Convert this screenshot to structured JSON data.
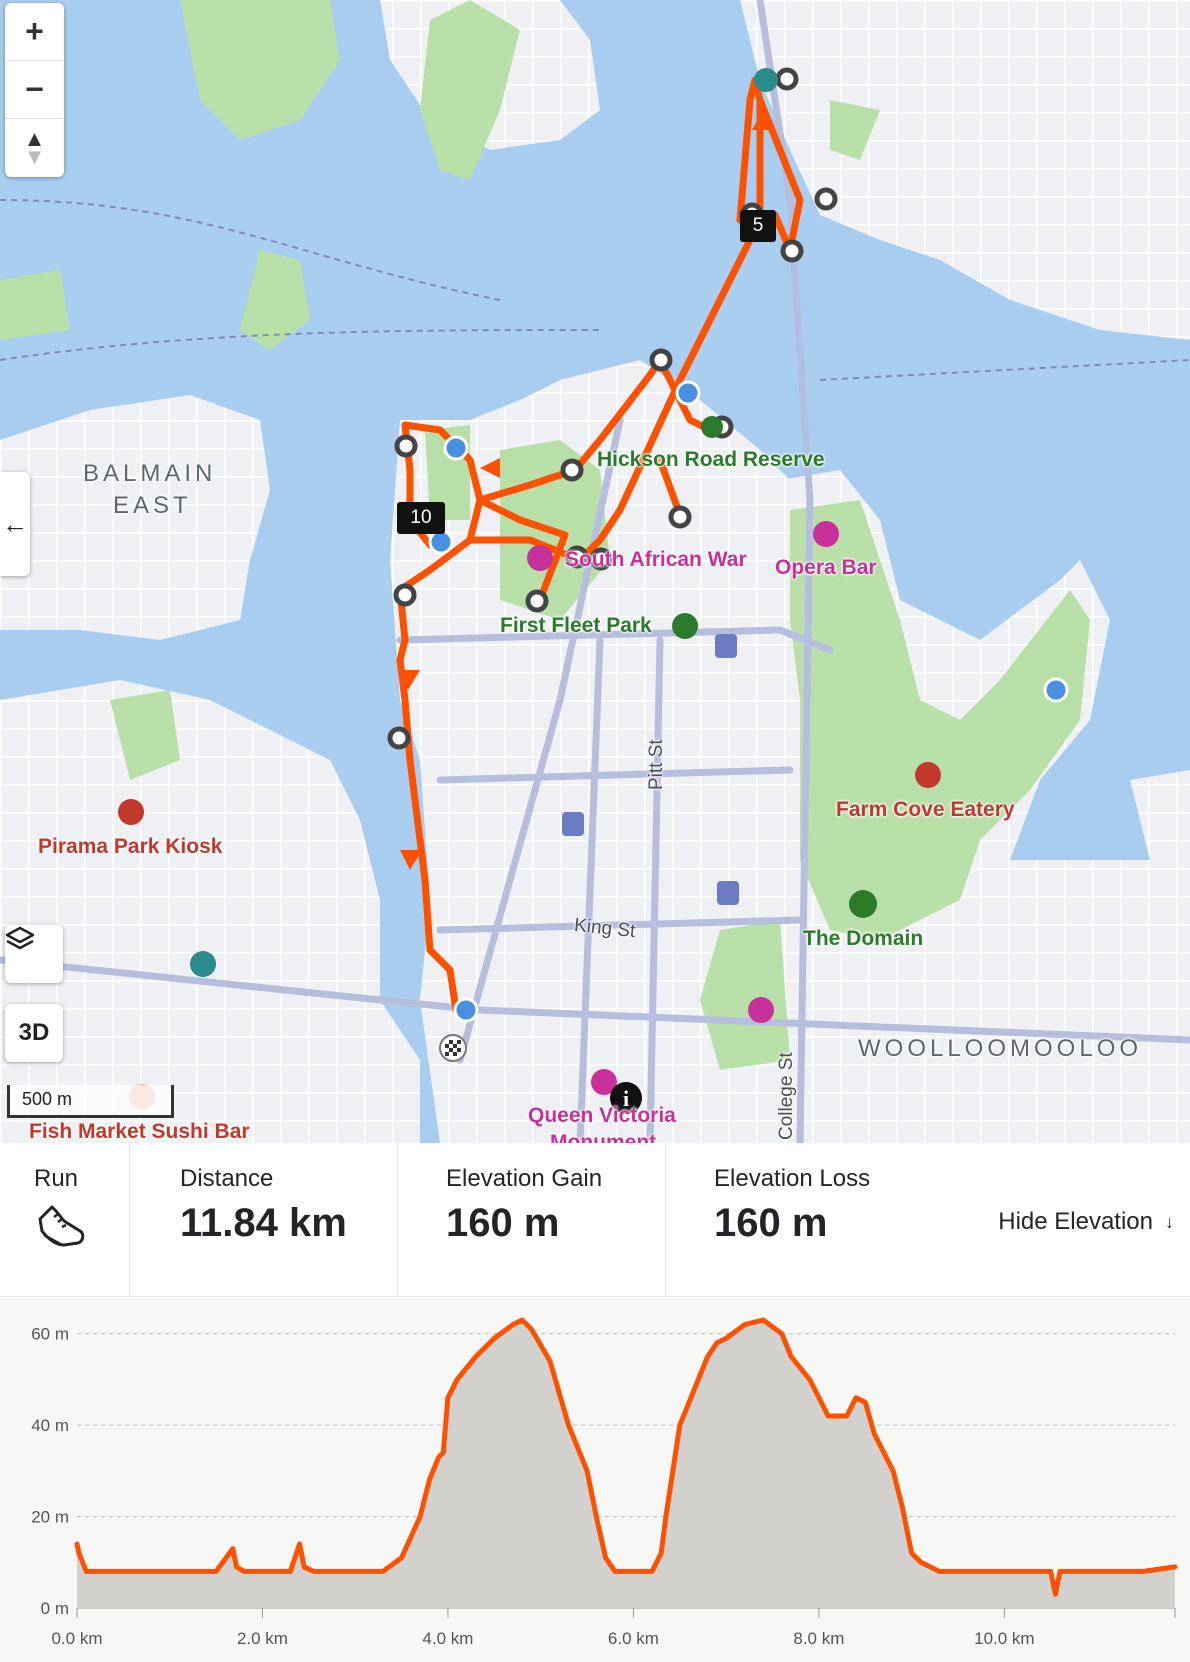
{
  "activity": {
    "type_label": "Run",
    "type_icon": "running-shoe-icon"
  },
  "stats": [
    {
      "label": "Distance",
      "value": "11.84 km"
    },
    {
      "label": "Elevation Gain",
      "value": "160 m"
    },
    {
      "label": "Elevation Loss",
      "value": "160 m"
    }
  ],
  "hide_elevation": {
    "label": "Hide Elevation",
    "icon": "arrow-down-icon"
  },
  "map": {
    "controls": {
      "zoom_in": "+",
      "zoom_out": "−",
      "compass": "▲",
      "layers_icon": "layers-icon",
      "three_d": "3D",
      "collapse_icon": "←"
    },
    "scale_label": "500 m",
    "labels": {
      "balmain": "BALMAIN",
      "east": "EAST",
      "hickson": "Hickson Road Reserve",
      "south_african_war": "South African War",
      "opera_bar": "Opera Bar",
      "first_fleet_park": "First Fleet Park",
      "farm_cove_eatery": "Farm Cove Eatery",
      "pirama_park_kiosk": "Pirama Park Kiosk",
      "the_domain": "The Domain",
      "king_st": "King St",
      "pitt_st": "Pitt St",
      "college_st": "College St",
      "woolloomooloo": "WOOLLOOMOOLOO",
      "queen_victoria": "Queen Victoria",
      "monument": "Monument",
      "fish_market_sushi_bar": "Fish Market Sushi Bar"
    },
    "km_markers": [
      "5",
      "10"
    ],
    "route_color": "#fc5200"
  },
  "chart_data": {
    "type": "area",
    "title": "",
    "xlabel": "",
    "ylabel": "",
    "x_unit": "km",
    "y_unit": "m",
    "xlim": [
      0,
      11.84
    ],
    "ylim": [
      0,
      63
    ],
    "x_ticks": [
      "0.0 km",
      "2.0 km",
      "4.0 km",
      "6.0 km",
      "8.0 km",
      "10.0 km"
    ],
    "y_ticks": [
      "0 m",
      "20 m",
      "40 m",
      "60 m"
    ],
    "grid": true,
    "line_color": "#fc5200",
    "fill_color": "#d2d1ce",
    "series": [
      {
        "x": [
          0,
          0.02,
          0.1,
          0.2,
          0.5,
          1.0,
          1.5,
          1.68,
          1.72,
          1.8,
          2.0,
          2.3,
          2.4,
          2.45,
          2.55,
          3.0,
          3.3,
          3.5,
          3.7,
          3.8,
          3.9,
          3.95,
          4.0,
          4.1,
          4.3,
          4.5,
          4.7,
          4.8,
          4.9,
          5.1,
          5.3,
          5.5,
          5.6,
          5.7,
          5.8,
          5.9,
          6.0,
          6.2,
          6.3,
          6.35,
          6.5,
          6.6,
          6.7,
          6.8,
          6.9,
          7.0,
          7.2,
          7.4,
          7.6,
          7.7,
          7.9,
          8.1,
          8.3,
          8.4,
          8.5,
          8.6,
          8.8,
          8.9,
          9.0,
          9.1,
          9.2,
          9.3,
          9.5,
          9.7,
          9.9,
          10.1,
          10.3,
          10.5,
          10.55,
          10.6,
          10.7,
          10.75,
          10.8,
          11.0,
          11.5,
          11.84
        ],
        "y": [
          14,
          12,
          8,
          8,
          8,
          8,
          8,
          13,
          9,
          8,
          8,
          8,
          14,
          9,
          8,
          8,
          8,
          11,
          20,
          28,
          33,
          34,
          46,
          50,
          55,
          59,
          62,
          63,
          61,
          54,
          40,
          30,
          20,
          11,
          8,
          8,
          8,
          8,
          12,
          20,
          40,
          45,
          50,
          55,
          58,
          59,
          62,
          63,
          60,
          55,
          50,
          42,
          42,
          46,
          45,
          38,
          30,
          22,
          12,
          10,
          9,
          8,
          8,
          8,
          8,
          8,
          8,
          8,
          3,
          8,
          8,
          8,
          8,
          8,
          8,
          9
        ]
      }
    ]
  }
}
